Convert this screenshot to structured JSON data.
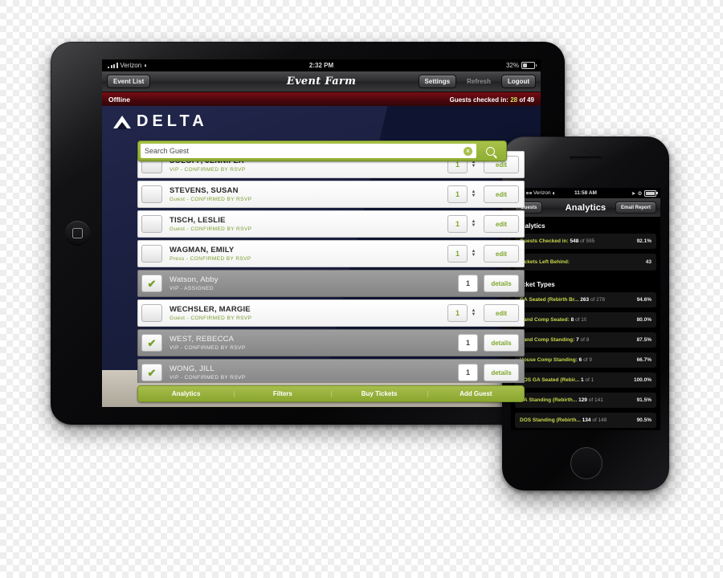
{
  "tablet": {
    "status_bar": {
      "carrier": "Verizon",
      "wifi_icon": "wifi-icon",
      "time": "2:32 PM",
      "battery_percent": "32%",
      "battery_icon": "battery-icon"
    },
    "nav": {
      "back_label": "Event List",
      "brand": "Event Farm",
      "settings_label": "Settings",
      "refresh_label": "Refresh",
      "logout_label": "Logout"
    },
    "offline_bar": {
      "status": "Offline",
      "checked_in_label": "Guests checked in:",
      "checked_in_count": "28",
      "checked_in_of": "of 49"
    },
    "branding": {
      "logo_name": "delta-logo",
      "wordmark": "DELTA"
    },
    "search": {
      "placeholder": "Search Guest",
      "clear_label": "x",
      "search_icon": "search-icon"
    },
    "guests": [
      {
        "name": "SOLOFF, JENNIFER",
        "type": "VIP",
        "status": "CONFIRMED BY RSVP",
        "qty": "1",
        "action": "edit",
        "checked_in": false
      },
      {
        "name": "STEVENS, SUSAN",
        "type": "Guest",
        "status": "CONFIRMED BY RSVP",
        "qty": "1",
        "action": "edit",
        "checked_in": false
      },
      {
        "name": "TISCH, LESLIE",
        "type": "Guest",
        "status": "CONFIRMED BY RSVP",
        "qty": "1",
        "action": "edit",
        "checked_in": false
      },
      {
        "name": "WAGMAN, EMILY",
        "type": "Press",
        "status": "CONFIRMED BY RSVP",
        "qty": "1",
        "action": "edit",
        "checked_in": false
      },
      {
        "name": "Watson, Abby",
        "type": "VIP",
        "status": "ASSIGNED",
        "qty": "1",
        "action": "details",
        "checked_in": true
      },
      {
        "name": "WECHSLER, MARGIE",
        "type": "Guest",
        "status": "CONFIRMED BY RSVP",
        "qty": "1",
        "action": "edit",
        "checked_in": false
      },
      {
        "name": "WEST, REBECCA",
        "type": "VIP",
        "status": "CONFIRMED BY RSVP",
        "qty": "1",
        "action": "details",
        "checked_in": true
      },
      {
        "name": "WONG, JILL",
        "type": "VIP",
        "status": "CONFIRMED BY RSVP",
        "qty": "1",
        "action": "details",
        "checked_in": true
      }
    ],
    "toolbar": [
      {
        "label": "Analytics"
      },
      {
        "label": "Filters"
      },
      {
        "label": "Buy Tickets"
      },
      {
        "label": "Add Guest"
      }
    ]
  },
  "phone": {
    "status_bar": {
      "carrier": "Verizon",
      "wifi_icon": "wifi-icon",
      "time": "11:58 AM",
      "location_icon": "location-arrow-icon",
      "rotation_icon": "rotation-lock-icon",
      "battery_icon": "battery-icon"
    },
    "nav": {
      "back_label": "Guests",
      "title": "Analytics",
      "action_label": "Email Report"
    },
    "sections": [
      {
        "heading": "Analytics",
        "rows": [
          {
            "label": "Guests Checked in:",
            "value": "548",
            "of": "of 595",
            "pct": "92.1%"
          },
          {
            "label": "Tickets Left Behind:",
            "value": "",
            "of": "",
            "pct": "43"
          }
        ]
      },
      {
        "heading": "Ticket Types",
        "rows": [
          {
            "label": "GA Seated (Rebirth Br...",
            "value": "263",
            "of": "of 278",
            "pct": "94.6%"
          },
          {
            "label": "Band Comp Seated:",
            "value": "8",
            "of": "of 10",
            "pct": "80.0%"
          },
          {
            "label": "Band Comp Standing:",
            "value": "7",
            "of": "of 8",
            "pct": "87.5%"
          },
          {
            "label": "House Comp Standing:",
            "value": "6",
            "of": "of 9",
            "pct": "66.7%"
          },
          {
            "label": "DOS GA Seated (Rebir...",
            "value": "1",
            "of": "of 1",
            "pct": "100.0%"
          },
          {
            "label": "GA Standing (Rebirth...",
            "value": "129",
            "of": "of 141",
            "pct": "91.5%"
          },
          {
            "label": "DOS Standing (Rebirth...",
            "value": "134",
            "of": "of 148",
            "pct": "90.5%"
          }
        ]
      }
    ]
  },
  "colors": {
    "accent_green": "#8fae33",
    "brand_navy": "#1b1f40",
    "offline_red": "#4a070c",
    "phone_label_green": "#c8d84a"
  }
}
